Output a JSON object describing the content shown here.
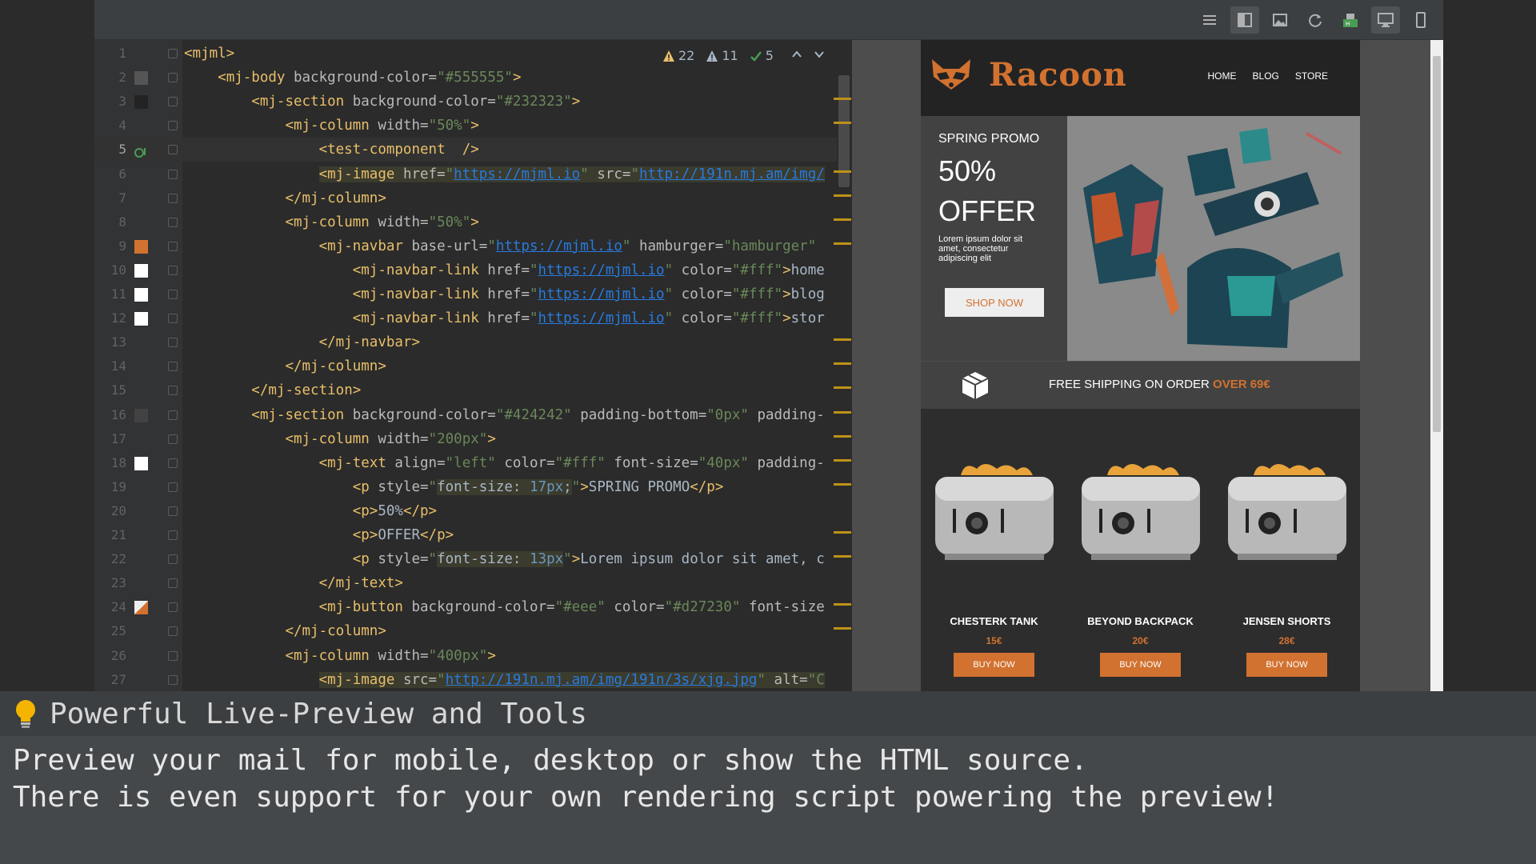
{
  "toolbar": {
    "icons": [
      "list-icon",
      "split-view-icon",
      "image-icon",
      "refresh-icon",
      "html-source-icon",
      "desktop-icon",
      "mobile-icon"
    ]
  },
  "problems": {
    "errors": "22",
    "warnings": "11",
    "ok": "5"
  },
  "editor": {
    "lines": [
      {
        "n": "1",
        "swatch": "",
        "parts": [
          [
            "tag",
            "<mjml>"
          ]
        ]
      },
      {
        "n": "2",
        "swatch": "#555555",
        "parts": [
          [
            "ind",
            "    "
          ],
          [
            "tag",
            "<mj-body "
          ],
          [
            "attr",
            "background-color="
          ],
          [
            "val",
            "\"#555555\""
          ],
          [
            "tag",
            ">"
          ]
        ]
      },
      {
        "n": "3",
        "swatch": "#232323",
        "parts": [
          [
            "ind",
            "        "
          ],
          [
            "tag",
            "<mj-section "
          ],
          [
            "attr",
            "background-color="
          ],
          [
            "val",
            "\"#232323\""
          ],
          [
            "tag",
            ">"
          ]
        ]
      },
      {
        "n": "4",
        "swatch": "",
        "parts": [
          [
            "ind",
            "            "
          ],
          [
            "tag",
            "<mj-column "
          ],
          [
            "attr",
            "width="
          ],
          [
            "val",
            "\"50%\""
          ],
          [
            "tag",
            ">"
          ]
        ]
      },
      {
        "n": "5",
        "swatch": "",
        "parts": [
          [
            "ind",
            "                "
          ],
          [
            "tag",
            "<test-component  />"
          ]
        ]
      },
      {
        "n": "6",
        "swatch": "",
        "parts": [
          [
            "ind",
            "                "
          ],
          [
            "tag",
            "<mj-image "
          ],
          [
            "attr",
            "href="
          ],
          [
            "val",
            "\""
          ],
          [
            "link",
            "https://mjml.io"
          ],
          [
            "val",
            "\" "
          ],
          [
            "attr",
            "src="
          ],
          [
            "val",
            "\""
          ],
          [
            "link",
            "http://191n.mj.am/img/"
          ]
        ]
      },
      {
        "n": "7",
        "swatch": "",
        "parts": [
          [
            "ind",
            "            "
          ],
          [
            "tag",
            "</mj-column>"
          ]
        ]
      },
      {
        "n": "8",
        "swatch": "",
        "parts": [
          [
            "ind",
            "            "
          ],
          [
            "tag",
            "<mj-column "
          ],
          [
            "attr",
            "width="
          ],
          [
            "val",
            "\"50%\""
          ],
          [
            "tag",
            ">"
          ]
        ]
      },
      {
        "n": "9",
        "swatch": "#d27230",
        "parts": [
          [
            "ind",
            "                "
          ],
          [
            "tag",
            "<mj-navbar "
          ],
          [
            "attr",
            "base-url="
          ],
          [
            "val",
            "\""
          ],
          [
            "link",
            "https://mjml.io"
          ],
          [
            "val",
            "\" "
          ],
          [
            "attr",
            "hamburger="
          ],
          [
            "val",
            "\"hamburger\""
          ]
        ]
      },
      {
        "n": "10",
        "swatch": "#ffffff",
        "parts": [
          [
            "ind",
            "                    "
          ],
          [
            "tag",
            "<mj-navbar-link "
          ],
          [
            "attr",
            "href="
          ],
          [
            "val",
            "\""
          ],
          [
            "link",
            "https://mjml.io"
          ],
          [
            "val",
            "\" "
          ],
          [
            "attr",
            "color="
          ],
          [
            "val",
            "\"#fff\""
          ],
          [
            "tag",
            ">"
          ],
          [
            "txt",
            "home"
          ]
        ]
      },
      {
        "n": "11",
        "swatch": "#ffffff",
        "parts": [
          [
            "ind",
            "                    "
          ],
          [
            "tag",
            "<mj-navbar-link "
          ],
          [
            "attr",
            "href="
          ],
          [
            "val",
            "\""
          ],
          [
            "link",
            "https://mjml.io"
          ],
          [
            "val",
            "\" "
          ],
          [
            "attr",
            "color="
          ],
          [
            "val",
            "\"#fff\""
          ],
          [
            "tag",
            ">"
          ],
          [
            "txt",
            "blog"
          ]
        ]
      },
      {
        "n": "12",
        "swatch": "#ffffff",
        "parts": [
          [
            "ind",
            "                    "
          ],
          [
            "tag",
            "<mj-navbar-link "
          ],
          [
            "attr",
            "href="
          ],
          [
            "val",
            "\""
          ],
          [
            "link",
            "https://mjml.io"
          ],
          [
            "val",
            "\" "
          ],
          [
            "attr",
            "color="
          ],
          [
            "val",
            "\"#fff\""
          ],
          [
            "tag",
            ">"
          ],
          [
            "txt",
            "stor"
          ]
        ]
      },
      {
        "n": "13",
        "swatch": "",
        "parts": [
          [
            "ind",
            "                "
          ],
          [
            "tag",
            "</mj-navbar>"
          ]
        ]
      },
      {
        "n": "14",
        "swatch": "",
        "parts": [
          [
            "ind",
            "            "
          ],
          [
            "tag",
            "</mj-column>"
          ]
        ]
      },
      {
        "n": "15",
        "swatch": "",
        "parts": [
          [
            "ind",
            "        "
          ],
          [
            "tag",
            "</mj-section>"
          ]
        ]
      },
      {
        "n": "16",
        "swatch": "#424242",
        "parts": [
          [
            "ind",
            "        "
          ],
          [
            "tag",
            "<mj-section "
          ],
          [
            "attr",
            "background-color="
          ],
          [
            "val",
            "\"#424242\" "
          ],
          [
            "attr",
            "padding-bottom="
          ],
          [
            "val",
            "\"0px\" "
          ],
          [
            "attr",
            "padding-"
          ]
        ]
      },
      {
        "n": "17",
        "swatch": "",
        "parts": [
          [
            "ind",
            "            "
          ],
          [
            "tag",
            "<mj-column "
          ],
          [
            "attr",
            "width="
          ],
          [
            "val",
            "\"200px\""
          ],
          [
            "tag",
            ">"
          ]
        ]
      },
      {
        "n": "18",
        "swatch": "#ffffff",
        "parts": [
          [
            "ind",
            "                "
          ],
          [
            "tag",
            "<mj-text "
          ],
          [
            "attr",
            "align="
          ],
          [
            "val",
            "\"left\" "
          ],
          [
            "attr",
            "color="
          ],
          [
            "val",
            "\"#fff\" "
          ],
          [
            "attr",
            "font-size="
          ],
          [
            "val",
            "\"40px\" "
          ],
          [
            "attr",
            "padding-"
          ]
        ]
      },
      {
        "n": "19",
        "swatch": "",
        "parts": [
          [
            "ind",
            "                    "
          ],
          [
            "tag",
            "<p "
          ],
          [
            "attr",
            "style="
          ],
          [
            "val",
            "\""
          ],
          [
            "hl",
            "font-size: "
          ],
          [
            "hlnum",
            "17px"
          ],
          [
            "hl",
            ";"
          ],
          [
            "val",
            "\""
          ],
          [
            "tag",
            ">"
          ],
          [
            "txt",
            "SPRING PROMO"
          ],
          [
            "tag",
            "</p>"
          ]
        ]
      },
      {
        "n": "20",
        "swatch": "",
        "parts": [
          [
            "ind",
            "                    "
          ],
          [
            "tag",
            "<p>"
          ],
          [
            "txt",
            "50%"
          ],
          [
            "tag",
            "</p>"
          ]
        ]
      },
      {
        "n": "21",
        "swatch": "",
        "parts": [
          [
            "ind",
            "                    "
          ],
          [
            "tag",
            "<p>"
          ],
          [
            "txt",
            "OFFER"
          ],
          [
            "tag",
            "</p>"
          ]
        ]
      },
      {
        "n": "22",
        "swatch": "",
        "parts": [
          [
            "ind",
            "                    "
          ],
          [
            "tag",
            "<p "
          ],
          [
            "attr",
            "style="
          ],
          [
            "val",
            "\""
          ],
          [
            "hl",
            "font-size: "
          ],
          [
            "hlnum",
            "13px"
          ],
          [
            "val",
            "\""
          ],
          [
            "tag",
            ">"
          ],
          [
            "txt",
            "Lorem ipsum dolor sit amet, c"
          ]
        ]
      },
      {
        "n": "23",
        "swatch": "",
        "parts": [
          [
            "ind",
            "                "
          ],
          [
            "tag",
            "</mj-text>"
          ]
        ]
      },
      {
        "n": "24",
        "swatch": "#d27230",
        "parts": [
          [
            "ind",
            "                "
          ],
          [
            "tag",
            "<mj-button "
          ],
          [
            "attr",
            "background-color="
          ],
          [
            "val",
            "\"#eee\" "
          ],
          [
            "attr",
            "color="
          ],
          [
            "val",
            "\"#d27230\" "
          ],
          [
            "attr",
            "font-size"
          ]
        ]
      },
      {
        "n": "25",
        "swatch": "",
        "parts": [
          [
            "ind",
            "            "
          ],
          [
            "tag",
            "</mj-column>"
          ]
        ]
      },
      {
        "n": "26",
        "swatch": "",
        "parts": [
          [
            "ind",
            "            "
          ],
          [
            "tag",
            "<mj-column "
          ],
          [
            "attr",
            "width="
          ],
          [
            "val",
            "\"400px\""
          ],
          [
            "tag",
            ">"
          ]
        ]
      },
      {
        "n": "27",
        "swatch": "",
        "parts": [
          [
            "ind",
            "                "
          ],
          [
            "tag",
            "<mj-image "
          ],
          [
            "attr",
            "src="
          ],
          [
            "val",
            "\""
          ],
          [
            "link",
            "http://191n.mj.am/img/191n/3s/xjg.jpg"
          ],
          [
            "val",
            "\" "
          ],
          [
            "attr",
            "alt="
          ],
          [
            "val",
            "\"C"
          ]
        ]
      }
    ]
  },
  "preview": {
    "brand": "Racoon",
    "nav": [
      "HOME",
      "BLOG",
      "STORE"
    ],
    "promo_small": "SPRING PROMO",
    "promo_big1": "50%",
    "promo_big2": "OFFER",
    "promo_text": "Lorem ipsum dolor sit amet, consectetur adipiscing elit",
    "shop_button": "SHOP NOW",
    "shipping_prefix": "FREE SHIPPING ON ORDER ",
    "shipping_highlight": "OVER 69€",
    "products": [
      {
        "name": "CHESTERK TANK",
        "price": "15€",
        "button": "BUY NOW"
      },
      {
        "name": "BEYOND BACKPACK",
        "price": "20€",
        "button": "BUY NOW"
      },
      {
        "name": "JENSEN SHORTS",
        "price": "28€",
        "button": "BUY NOW"
      }
    ],
    "colors": {
      "accent": "#d27230",
      "header_bg": "#232323",
      "section_bg": "#424242"
    }
  },
  "caption": {
    "title": "Powerful Live-Preview and Tools",
    "line1": "Preview your mail for mobile, desktop or show the HTML source.",
    "line2": "There is even support for your own rendering script powering the preview!"
  }
}
